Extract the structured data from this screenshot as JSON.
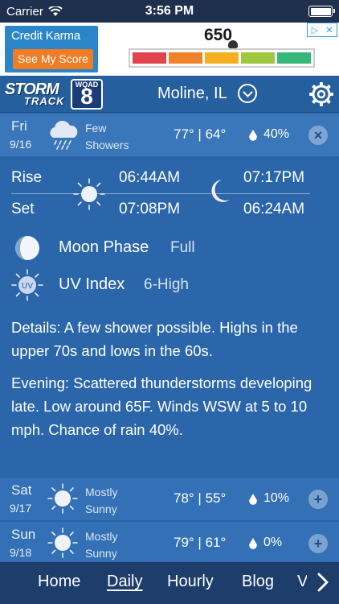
{
  "status_bar": {
    "carrier": "Carrier",
    "time": "3:56 PM",
    "icons": [
      "wifi-icon",
      "battery-icon"
    ]
  },
  "ad": {
    "brand": "Credit Karma",
    "cta": "See My Score",
    "score": "650",
    "scale_colors": [
      "#e0454f",
      "#f0822a",
      "#f5b020",
      "#9dc83f",
      "#37b77a"
    ],
    "choices_icon": "ad-choices-icon"
  },
  "header": {
    "logo_storm": "STORM",
    "logo_track": "TRACK",
    "logo_station": "WQAD",
    "logo_number": "8",
    "location": "Moline, IL",
    "icons": [
      "chevron-down-icon",
      "gear-icon"
    ]
  },
  "selected_day": {
    "name": "Fri",
    "date": "9/16",
    "condition": "Few Showers",
    "icon": "rain-cloud-icon",
    "temps": "77° | 64°",
    "precip": "40%",
    "action": "×"
  },
  "details": {
    "rise_label": "Rise",
    "set_label": "Set",
    "sun_rise": "06:44AM",
    "sun_set": "07:08PM",
    "moon_rise": "07:17PM",
    "moon_set": "06:24AM",
    "moon_phase_label": "Moon Phase",
    "moon_phase_value": "Full",
    "uv_label": "UV Index",
    "uv_value": "6-High",
    "uv_icon_text": "UV",
    "details_text": "Details: A few shower possible. Highs in the upper 70s and lows in the 60s.",
    "evening_text": "Evening: Scattered thunderstorms developing late. Low around 65F. Winds WSW at 5 to 10 mph. Chance of rain 40%."
  },
  "forecast": [
    {
      "name": "Sat",
      "date": "9/17",
      "condition": "Mostly Sunny",
      "icon": "sun-icon",
      "temps": "78° | 55°",
      "precip": "10%",
      "action": "+"
    },
    {
      "name": "Sun",
      "date": "9/18",
      "condition": "Mostly Sunny",
      "icon": "sun-icon",
      "temps": "79° | 61°",
      "precip": "0%",
      "action": "+"
    }
  ],
  "nav": {
    "items": [
      "Home",
      "Daily",
      "Hourly",
      "Blog",
      "V"
    ],
    "active": "Daily",
    "more_icon": "chevron-right-icon"
  },
  "colors": {
    "background": "#2a64a8",
    "header": "#255f9d",
    "nav": "#1d3d6b",
    "ad_brand": "#2a86c8",
    "ad_cta": "#f07c26"
  }
}
